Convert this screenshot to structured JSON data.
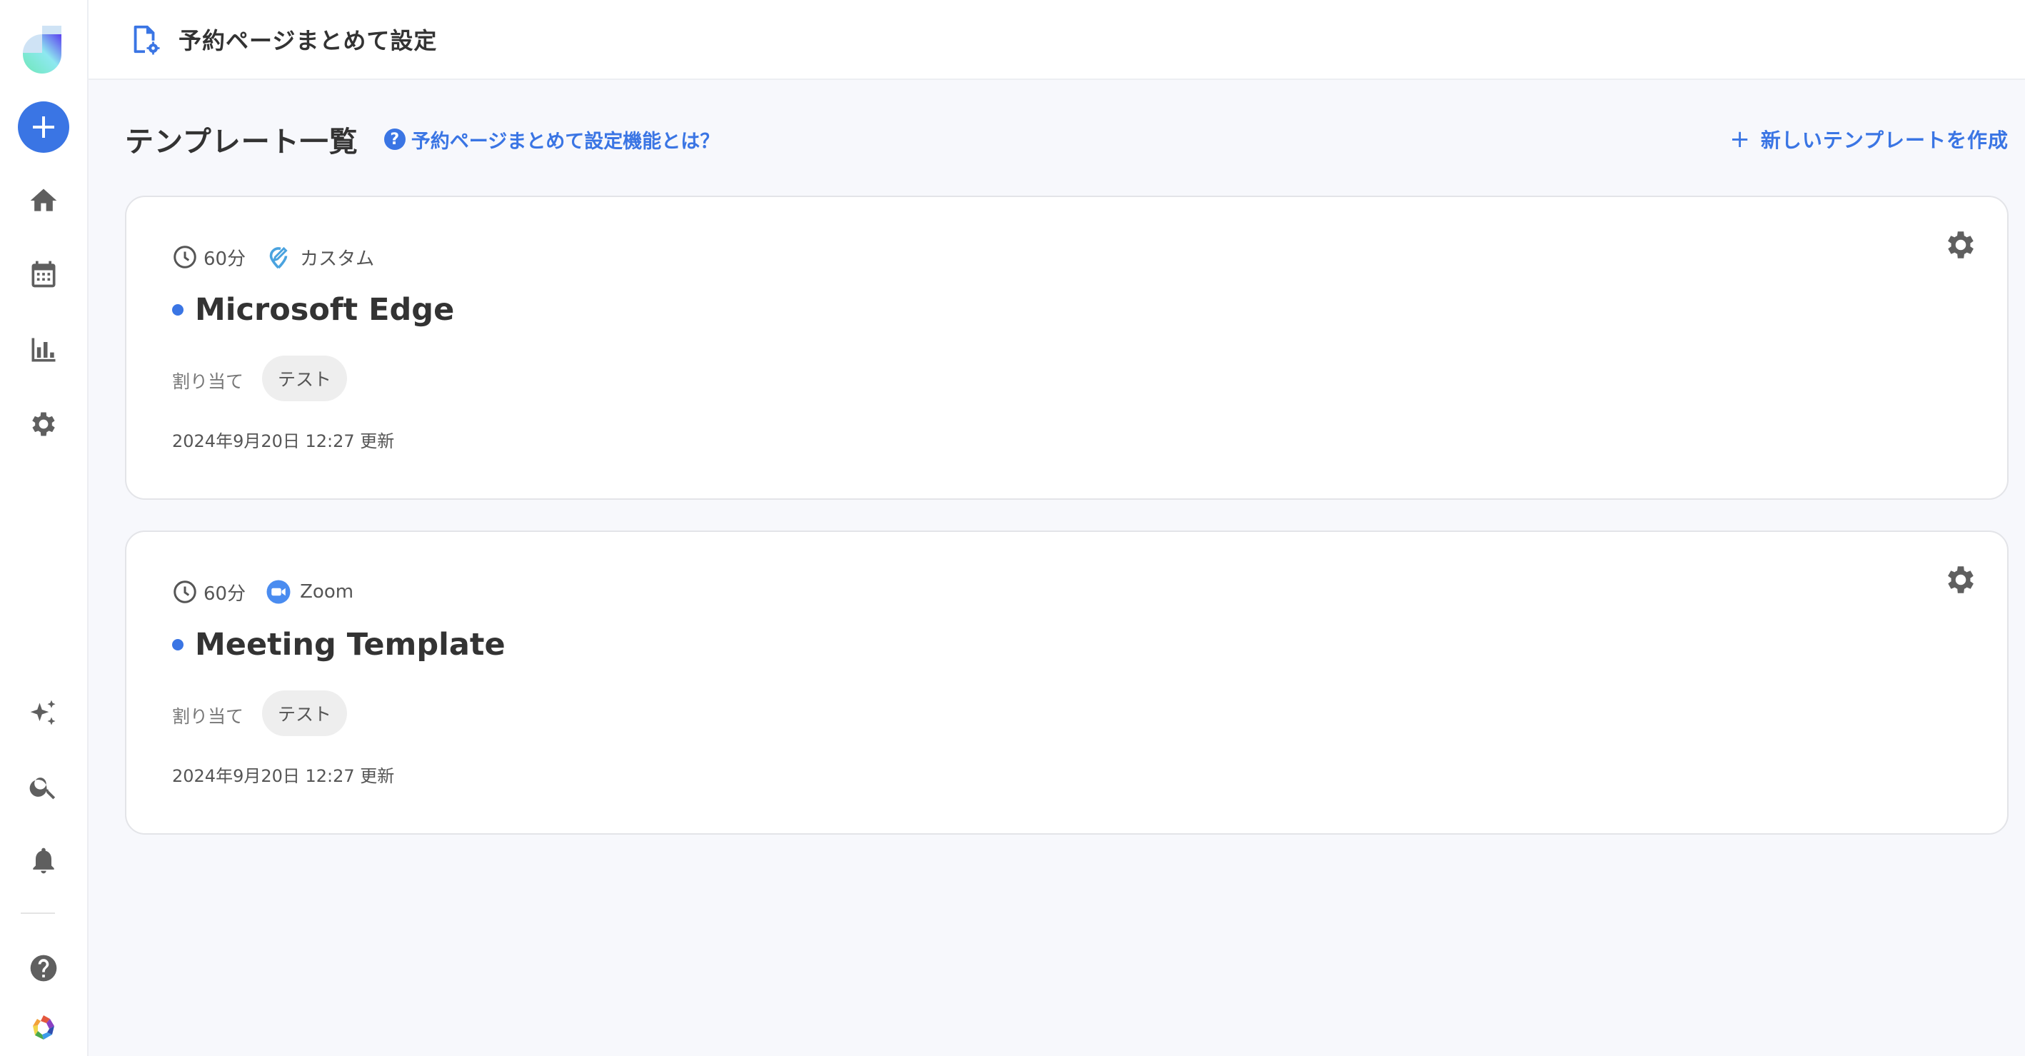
{
  "sidebar": {
    "logo": "app-logo",
    "create_button": "plus-icon",
    "nav_top": [
      {
        "name": "home",
        "icon": "home-icon"
      },
      {
        "name": "calendar",
        "icon": "calendar-icon"
      },
      {
        "name": "analytics",
        "icon": "bar-chart-icon"
      },
      {
        "name": "settings",
        "icon": "gear-icon"
      }
    ],
    "nav_bottom": [
      {
        "name": "ai",
        "icon": "sparkles-icon"
      },
      {
        "name": "search",
        "icon": "search-icon"
      },
      {
        "name": "notifications",
        "icon": "bell-icon"
      },
      {
        "name": "help",
        "icon": "help-icon"
      },
      {
        "name": "apps",
        "icon": "app-switcher-icon"
      }
    ]
  },
  "header": {
    "icon": "file-settings-icon",
    "title": "予約ページまとめて設定"
  },
  "section": {
    "title": "テンプレート一覧",
    "help_link_icon": "?",
    "help_link": "予約ページまとめて設定機能とは？",
    "new_template_icon": "+",
    "new_template": "新しいテンプレートを作成"
  },
  "colors": {
    "accent": "#3a75e4",
    "custom_location": "#4aa3df",
    "zoom": "#4a8cf0",
    "text": "#333333",
    "chip_bg": "#eeeeee"
  },
  "templates": [
    {
      "duration": "60分",
      "location_type": "custom",
      "location_icon": "custom-location-icon",
      "location": "カスタム",
      "name": "Microsoft Edge",
      "assign_label": "割り当て",
      "assignee": "テスト",
      "updated": "2024年9月20日 12:27 更新"
    },
    {
      "duration": "60分",
      "location_type": "zoom",
      "location_icon": "zoom-icon",
      "location": "Zoom",
      "name": "Meeting Template",
      "assign_label": "割り当て",
      "assignee": "テスト",
      "updated": "2024年9月20日 12:27 更新"
    }
  ]
}
